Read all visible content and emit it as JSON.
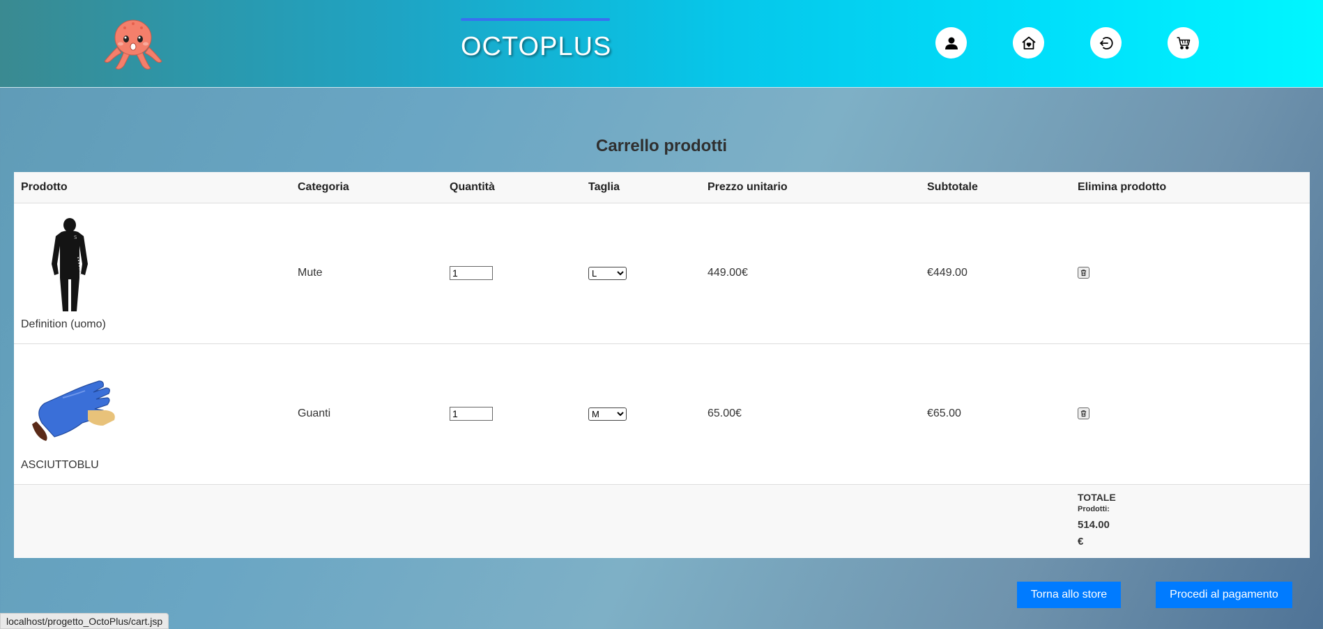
{
  "header": {
    "brand": "OCTOPLUS",
    "icons": [
      "user-icon",
      "home-heart-icon",
      "logout-icon",
      "cart-icon"
    ]
  },
  "page_title": "Carrello prodotti",
  "table": {
    "headers": [
      "Prodotto",
      "Categoria",
      "Quantità",
      "Taglia",
      "Prezzo unitario",
      "Subtotale",
      "Elimina prodotto"
    ],
    "rows": [
      {
        "name": "Definition (uomo)",
        "category": "Mute",
        "quantity": "1",
        "size": "L",
        "unit_price": "449.00€",
        "subtotal": "€449.00",
        "image": "wetsuit"
      },
      {
        "name": "ASCIUTTOBLU",
        "category": "Guanti",
        "quantity": "1",
        "size": "M",
        "unit_price": "65.00€",
        "subtotal": "€65.00",
        "image": "glove"
      }
    ],
    "total_label": "TOTALE",
    "total_sub": "Prodotti:",
    "total_value": "514.00",
    "total_currency": "€"
  },
  "buttons": {
    "back": "Torna allo store",
    "pay": "Procedi al pagamento"
  },
  "status_url": "localhost/progetto_OctoPlus/cart.jsp",
  "colors": {
    "button": "#007bff",
    "accent_line": "#3a6ff0"
  }
}
